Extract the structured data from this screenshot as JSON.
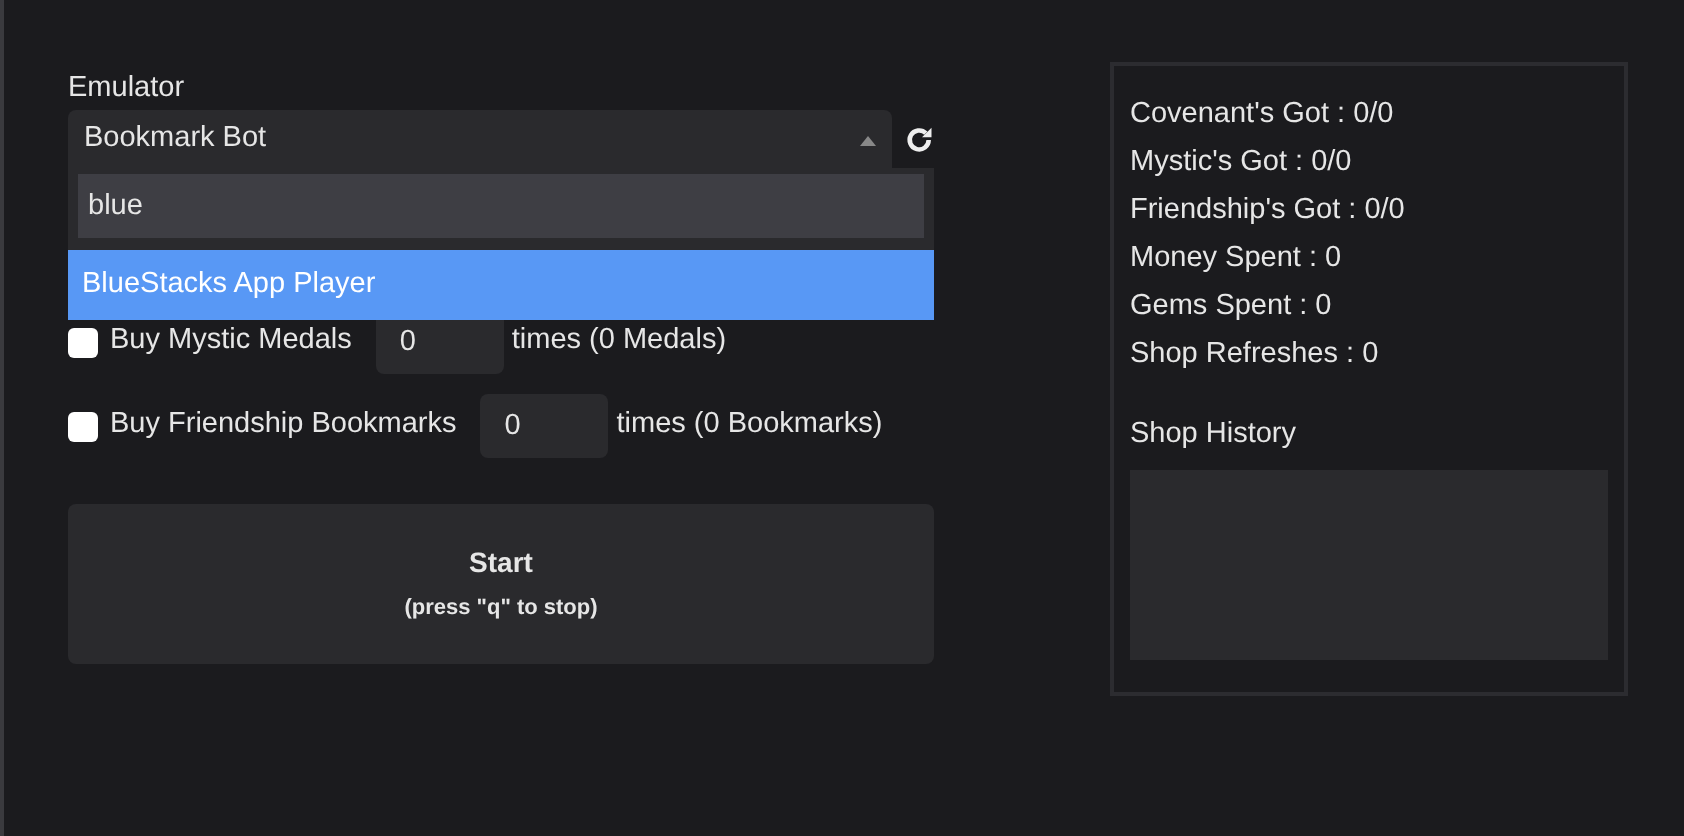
{
  "emulator": {
    "label": "Emulator",
    "value": "Bookmark Bot",
    "expanded": true,
    "search": "blue",
    "options": [
      {
        "label": "BlueStacks App Player",
        "selected": true
      }
    ]
  },
  "purchases": [
    {
      "label": "Buy Mystic Medals",
      "checked": false,
      "count": "0",
      "suffix": "times (0 Medals)"
    },
    {
      "label": "Buy Friendship Bookmarks",
      "checked": false,
      "count": "0",
      "suffix": "times (0 Bookmarks)"
    }
  ],
  "start": {
    "label": "Start",
    "hint": "(press \"q\" to stop)"
  },
  "stats": [
    "Covenant's Got : 0/0",
    "Mystic's Got : 0/0",
    "Friendship's Got : 0/0",
    "Money Spent : 0",
    "Gems Spent : 0",
    "Shop Refreshes : 0"
  ],
  "history": {
    "title": "Shop History"
  }
}
